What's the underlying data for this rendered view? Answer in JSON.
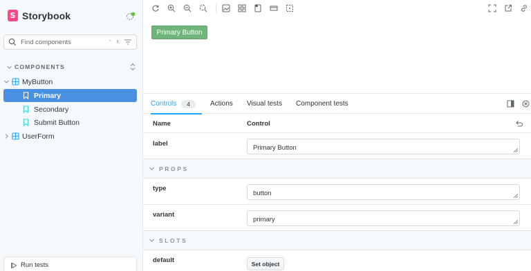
{
  "brand": {
    "name": "Storybook",
    "logo_letter": "S",
    "accent": "#ff4785",
    "status_dot_color": "#66bf3c"
  },
  "sidebar": {
    "search_placeholder": "Find components",
    "search_shortcut": "⌃ K",
    "section_label": "COMPONENTS",
    "tree": [
      {
        "label": "MyButton",
        "type": "component",
        "expanded": true
      },
      {
        "label": "Primary",
        "type": "story",
        "selected": true
      },
      {
        "label": "Secondary",
        "type": "story"
      },
      {
        "label": "Submit Button",
        "type": "story"
      },
      {
        "label": "UserForm",
        "type": "component",
        "expanded": false
      }
    ],
    "run_tests_label": "Run tests"
  },
  "toolbar": {
    "icons": [
      "reload-icon",
      "zoom-in-icon",
      "zoom-out-icon",
      "zoom-reset-icon",
      "background-icon",
      "grid-icon",
      "viewport-icon",
      "measure-icon",
      "outline-icon",
      "fullscreen-icon",
      "share-icon",
      "copy-link-icon"
    ]
  },
  "preview": {
    "button_label": "Primary Button",
    "button_color": "#6fb57b"
  },
  "addons": {
    "tabs": [
      {
        "label": "Controls",
        "count": "4",
        "active": true
      },
      {
        "label": "Actions"
      },
      {
        "label": "Visual tests"
      },
      {
        "label": "Component tests"
      }
    ],
    "table": {
      "col_name": "Name",
      "col_control": "Control",
      "label_row": {
        "name": "label",
        "value": "Primary Button"
      },
      "props_heading": "PROPS",
      "props": [
        {
          "name": "type",
          "value": "button"
        },
        {
          "name": "variant",
          "value": "primary"
        }
      ],
      "slots_heading": "SLOTS",
      "slot_row": {
        "name": "default",
        "button": "Set object"
      }
    }
  },
  "colors": {
    "selected_bg": "#4a90e2",
    "active_tab": "#1ea7fd"
  }
}
